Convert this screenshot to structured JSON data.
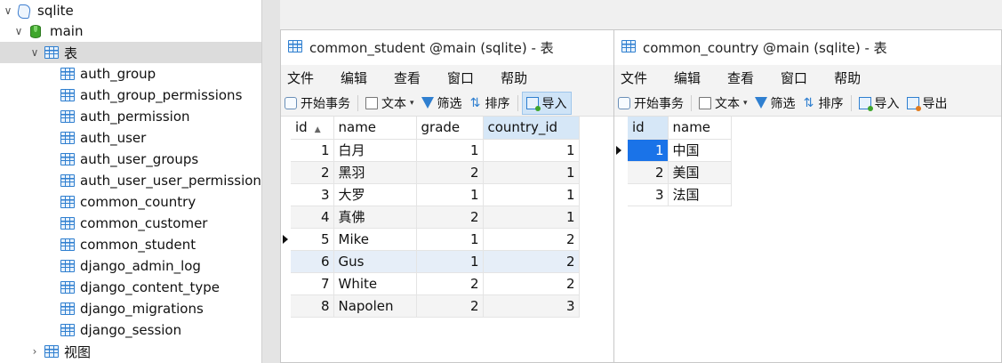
{
  "tree": {
    "root": "sqlite",
    "schema": "main",
    "tables_folder": "表",
    "tables": [
      "auth_group",
      "auth_group_permissions",
      "auth_permission",
      "auth_user",
      "auth_user_groups",
      "auth_user_user_permissions",
      "common_country",
      "common_customer",
      "common_student",
      "django_admin_log",
      "django_content_type",
      "django_migrations",
      "django_session"
    ],
    "views_folder": "视图"
  },
  "menu": [
    "文件",
    "编辑",
    "查看",
    "窗口",
    "帮助"
  ],
  "toolbar": {
    "begin_tx": "开始事务",
    "text": "文本",
    "filter": "筛选",
    "sort": "排序",
    "import": "导入",
    "export": "导出"
  },
  "student_window": {
    "title": "common_student @main (sqlite) - 表",
    "columns": [
      "id",
      "name",
      "grade",
      "country_id"
    ],
    "rows": [
      [
        "1",
        "白月",
        "1",
        "1"
      ],
      [
        "2",
        "黑羽",
        "2",
        "1"
      ],
      [
        "3",
        "大罗",
        "1",
        "1"
      ],
      [
        "4",
        "真佛",
        "2",
        "1"
      ],
      [
        "5",
        "Mike",
        "1",
        "2"
      ],
      [
        "6",
        "Gus",
        "1",
        "2"
      ],
      [
        "7",
        "White",
        "2",
        "2"
      ],
      [
        "8",
        "Napolen",
        "2",
        "3"
      ]
    ]
  },
  "country_window": {
    "title": "common_country @main (sqlite) - 表",
    "columns": [
      "id",
      "name"
    ],
    "rows": [
      [
        "1",
        "中国"
      ],
      [
        "2",
        "美国"
      ],
      [
        "3",
        "法国"
      ]
    ]
  }
}
